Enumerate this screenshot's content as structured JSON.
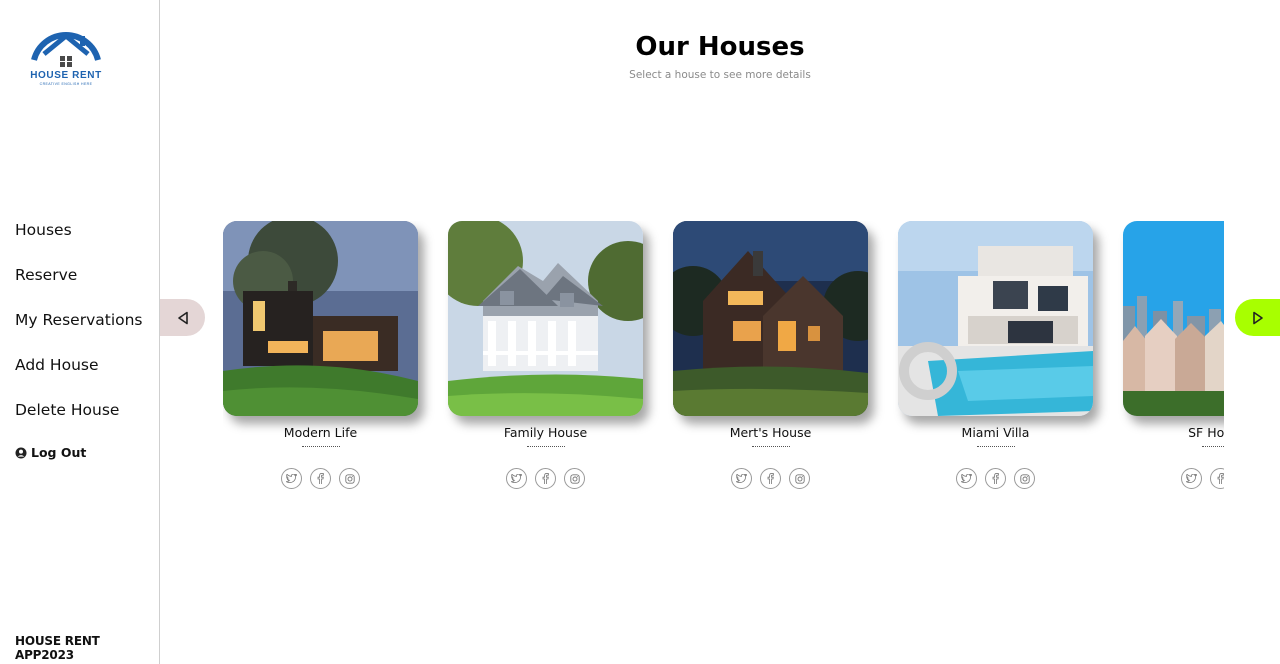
{
  "sidebar": {
    "logo": {
      "text": "HOUSE RENT",
      "tagline": "CREATIVE ENGLISH HERE"
    },
    "nav": [
      {
        "label": "Houses"
      },
      {
        "label": "Reserve"
      },
      {
        "label": "My Reservations"
      },
      {
        "label": "Add House"
      },
      {
        "label": "Delete House"
      }
    ],
    "logout_label": "Log Out",
    "footer": "HOUSE RENT APP2023"
  },
  "main": {
    "title": "Our Houses",
    "subtitle": "Select a house to see more details"
  },
  "houses": [
    {
      "name": "Modern Life"
    },
    {
      "name": "Family House"
    },
    {
      "name": "Mert's House"
    },
    {
      "name": "Miami Villa"
    },
    {
      "name": "SF Houses"
    }
  ],
  "icons": {
    "prev": "arrow-left-icon",
    "next": "arrow-right-icon",
    "social": [
      "twitter-icon",
      "facebook-icon",
      "instagram-icon"
    ]
  },
  "colors": {
    "brand": "#1e63b0",
    "next_button": "#a8ff00",
    "prev_button": "#e4d6d6"
  }
}
